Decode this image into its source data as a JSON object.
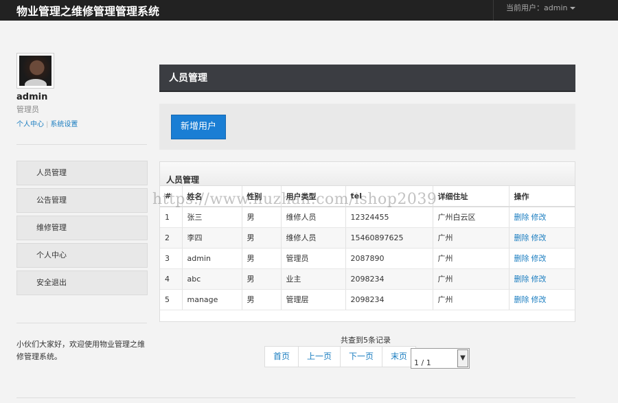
{
  "header": {
    "title": "物业管理之维修管理管理系统",
    "current_user": "当前用户：admin"
  },
  "sidebar": {
    "username": "admin",
    "role": "管理员",
    "links": [
      "个人中心",
      "系统设置"
    ],
    "nav": [
      "人员管理",
      "公告管理",
      "维修管理",
      "个人中心",
      "安全退出"
    ],
    "welcome": "小伙们大家好，欢迎使用物业管理之维修管理系统。"
  },
  "main": {
    "panel_title": "人员管理",
    "add_button": "新增用户",
    "table_title": "人员管理",
    "columns": [
      "#",
      "姓名",
      "性别",
      "用户类型",
      "tel",
      "详细住址",
      "操作"
    ],
    "rows": [
      {
        "id": "1",
        "name": "张三",
        "gender": "男",
        "type": "维修人员",
        "tel": "12324455",
        "address": "广州白云区"
      },
      {
        "id": "2",
        "name": "李四",
        "gender": "男",
        "type": "维修人员",
        "tel": "15460897625",
        "address": "广州"
      },
      {
        "id": "3",
        "name": "admin",
        "gender": "男",
        "type": "管理员",
        "tel": "2087890",
        "address": "广州"
      },
      {
        "id": "4",
        "name": "abc",
        "gender": "男",
        "type": "业主",
        "tel": "2098234",
        "address": "广州"
      },
      {
        "id": "5",
        "name": "manage",
        "gender": "男",
        "type": "管理层",
        "tel": "2098234",
        "address": "广州"
      }
    ],
    "actions": {
      "delete": "删除",
      "edit": "修改"
    },
    "total": "共查到5条记录",
    "pager": [
      "首页",
      "上一页",
      "下一页",
      "末页"
    ],
    "page_select": "1 / 1"
  },
  "watermark": "https://www.huzhan.com/ishop2039",
  "colors": {
    "topbar": "#222222",
    "accent": "#1a7ed4",
    "panel_head": "#3b3d42"
  }
}
